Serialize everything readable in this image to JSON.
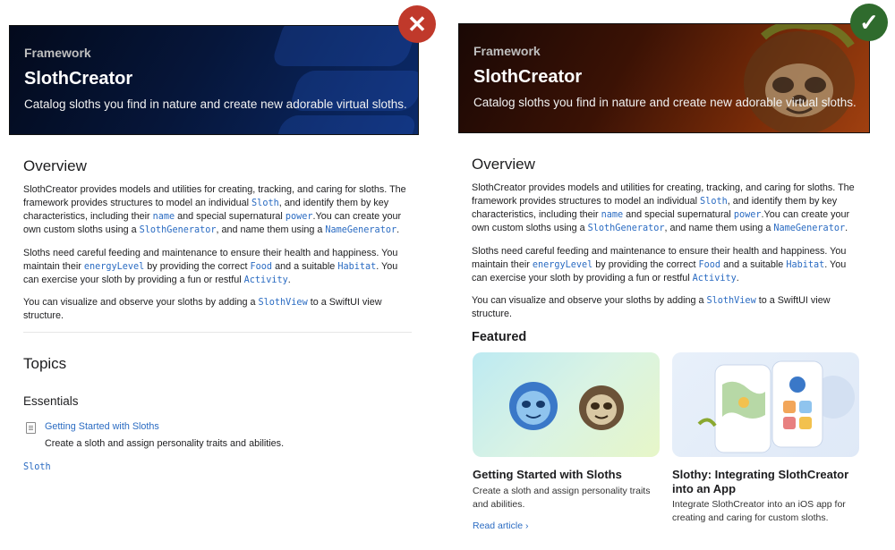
{
  "left": {
    "badge": "✕",
    "hero": {
      "kicker": "Framework",
      "title": "SlothCreator",
      "subtitle": "Catalog sloths you find in nature and create new adorable virtual sloths."
    },
    "overview": {
      "heading": "Overview",
      "p1": {
        "t1": "SlothCreator provides models and utilities for creating, tracking, and caring for sloths. The framework provides structures to model an individual ",
        "c1": "Sloth",
        "t2": ", and identify them by key characteristics, including their ",
        "c2": "name",
        "t3": " and special supernatural ",
        "c3": "power",
        "t4": ".You can create your own custom sloths using a ",
        "c4": "SlothGenerator",
        "t5": ", and name them using a ",
        "c5": "NameGenerator",
        "t6": "."
      },
      "p2": {
        "t1": "Sloths need careful feeding and maintenance to ensure their health and happiness. You maintain their ",
        "c1": "energyLevel",
        "t2": " by providing the correct ",
        "c2": "Food",
        "t3": " and a suitable ",
        "c3": "Habitat",
        "t4": ". You can exercise your sloth by providing a fun or restful ",
        "c4": "Activity",
        "t5": "."
      },
      "p3": {
        "t1": "You can visualize and observe your sloths by adding a ",
        "c1": "SlothView",
        "t2": " to a SwiftUI view structure."
      }
    },
    "topics": {
      "heading": "Topics",
      "essentials": "Essentials",
      "item_title": "Getting Started with Sloths",
      "item_desc": "Create a sloth and assign personality traits and abilities.",
      "symbol": "Sloth"
    }
  },
  "right": {
    "badge": "✓",
    "hero": {
      "kicker": "Framework",
      "title": "SlothCreator",
      "subtitle": "Catalog sloths you find in nature and create new adorable virtual sloths."
    },
    "overview": {
      "heading": "Overview",
      "p1": {
        "t1": "SlothCreator provides models and utilities for creating, tracking, and caring for sloths. The framework provides structures to model an individual ",
        "c1": "Sloth",
        "t2": ", and identify them by key characteristics, including their ",
        "c2": "name",
        "t3": " and special supernatural ",
        "c3": "power",
        "t4": ".You can create your own custom sloths using a ",
        "c4": "SlothGenerator",
        "t5": ", and name them using a ",
        "c5": "NameGenerator",
        "t6": "."
      },
      "p2": {
        "t1": "Sloths need careful feeding and maintenance to ensure their health and happiness. You maintain their ",
        "c1": "energyLevel",
        "t2": " by providing the correct ",
        "c2": "Food",
        "t3": " and a suitable ",
        "c3": "Habitat",
        "t4": ". You can exercise your sloth by providing a fun or restful ",
        "c4": "Activity",
        "t5": "."
      },
      "p3": {
        "t1": "You can visualize and observe your sloths by adding a ",
        "c1": "SlothView",
        "t2": " to a SwiftUI view structure."
      }
    },
    "featured": {
      "heading": "Featured",
      "card1": {
        "title": "Getting Started with Sloths",
        "desc": "Create a sloth and assign personality traits and abilities.",
        "link": "Read article ›"
      },
      "card2": {
        "title": "Slothy: Integrating SlothCreator into an App",
        "desc": "Integrate SlothCreator into an iOS app for creating and caring for custom sloths."
      }
    }
  },
  "colors": {
    "link": "#2a6bc2",
    "bad": "#c0392b",
    "good": "#2f6b2d"
  }
}
